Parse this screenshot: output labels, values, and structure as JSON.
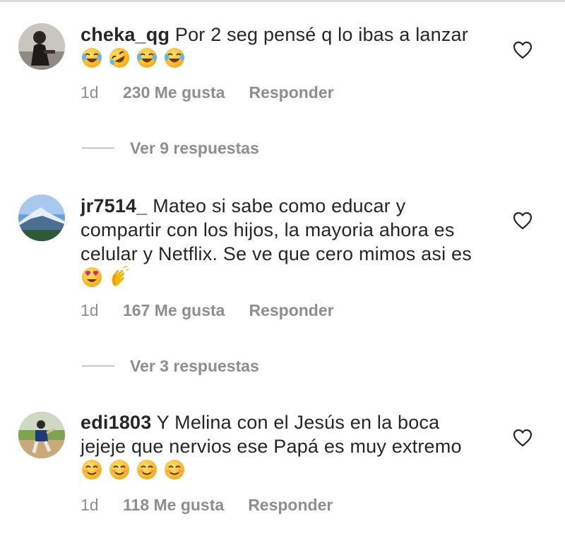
{
  "comments": [
    {
      "username": "cheka_qg",
      "text": "Por 2 seg pensé q lo ibas a lanzar",
      "emojis": [
        "face-with-tears-of-joy",
        "rolling-on-the-floor-laughing",
        "face-with-tears-of-joy",
        "face-with-tears-of-joy"
      ],
      "time": "1d",
      "likes": "230 Me gusta",
      "reply_label": "Responder",
      "view_replies": "Ver 9 respuestas",
      "avatar": "person-photo-avatar",
      "like_icon": "heart-outline-icon"
    },
    {
      "username": "jr7514_",
      "text": "Mateo si sabe como educar y compartir con los hijos, la mayoria ahora es celular y Netflix. Se ve que cero mimos asi es",
      "emojis": [
        "smiling-face-with-heart-eyes",
        "clapping-hands"
      ],
      "time": "1d",
      "likes": "167 Me gusta",
      "reply_label": "Responder",
      "view_replies": "Ver 3 respuestas",
      "avatar": "mountain-landscape-avatar",
      "like_icon": "heart-outline-icon"
    },
    {
      "username": "edi1803",
      "text": "Y Melina con el Jesús en la boca jejeje que nervios ese Papá es muy extremo",
      "emojis": [
        "smiling-face-with-smiling-eyes",
        "smiling-face-with-smiling-eyes",
        "smiling-face-with-smiling-eyes",
        "smiling-face-with-smiling-eyes"
      ],
      "time": "1d",
      "likes": "118 Me gusta",
      "reply_label": "Responder",
      "avatar": "baseball-player-avatar",
      "like_icon": "heart-outline-icon"
    }
  ],
  "colors": {
    "text": "#262626",
    "secondary": "#8e8e8e",
    "divider": "#c7c7c7",
    "emoji_yellow": "#fcc21b"
  }
}
